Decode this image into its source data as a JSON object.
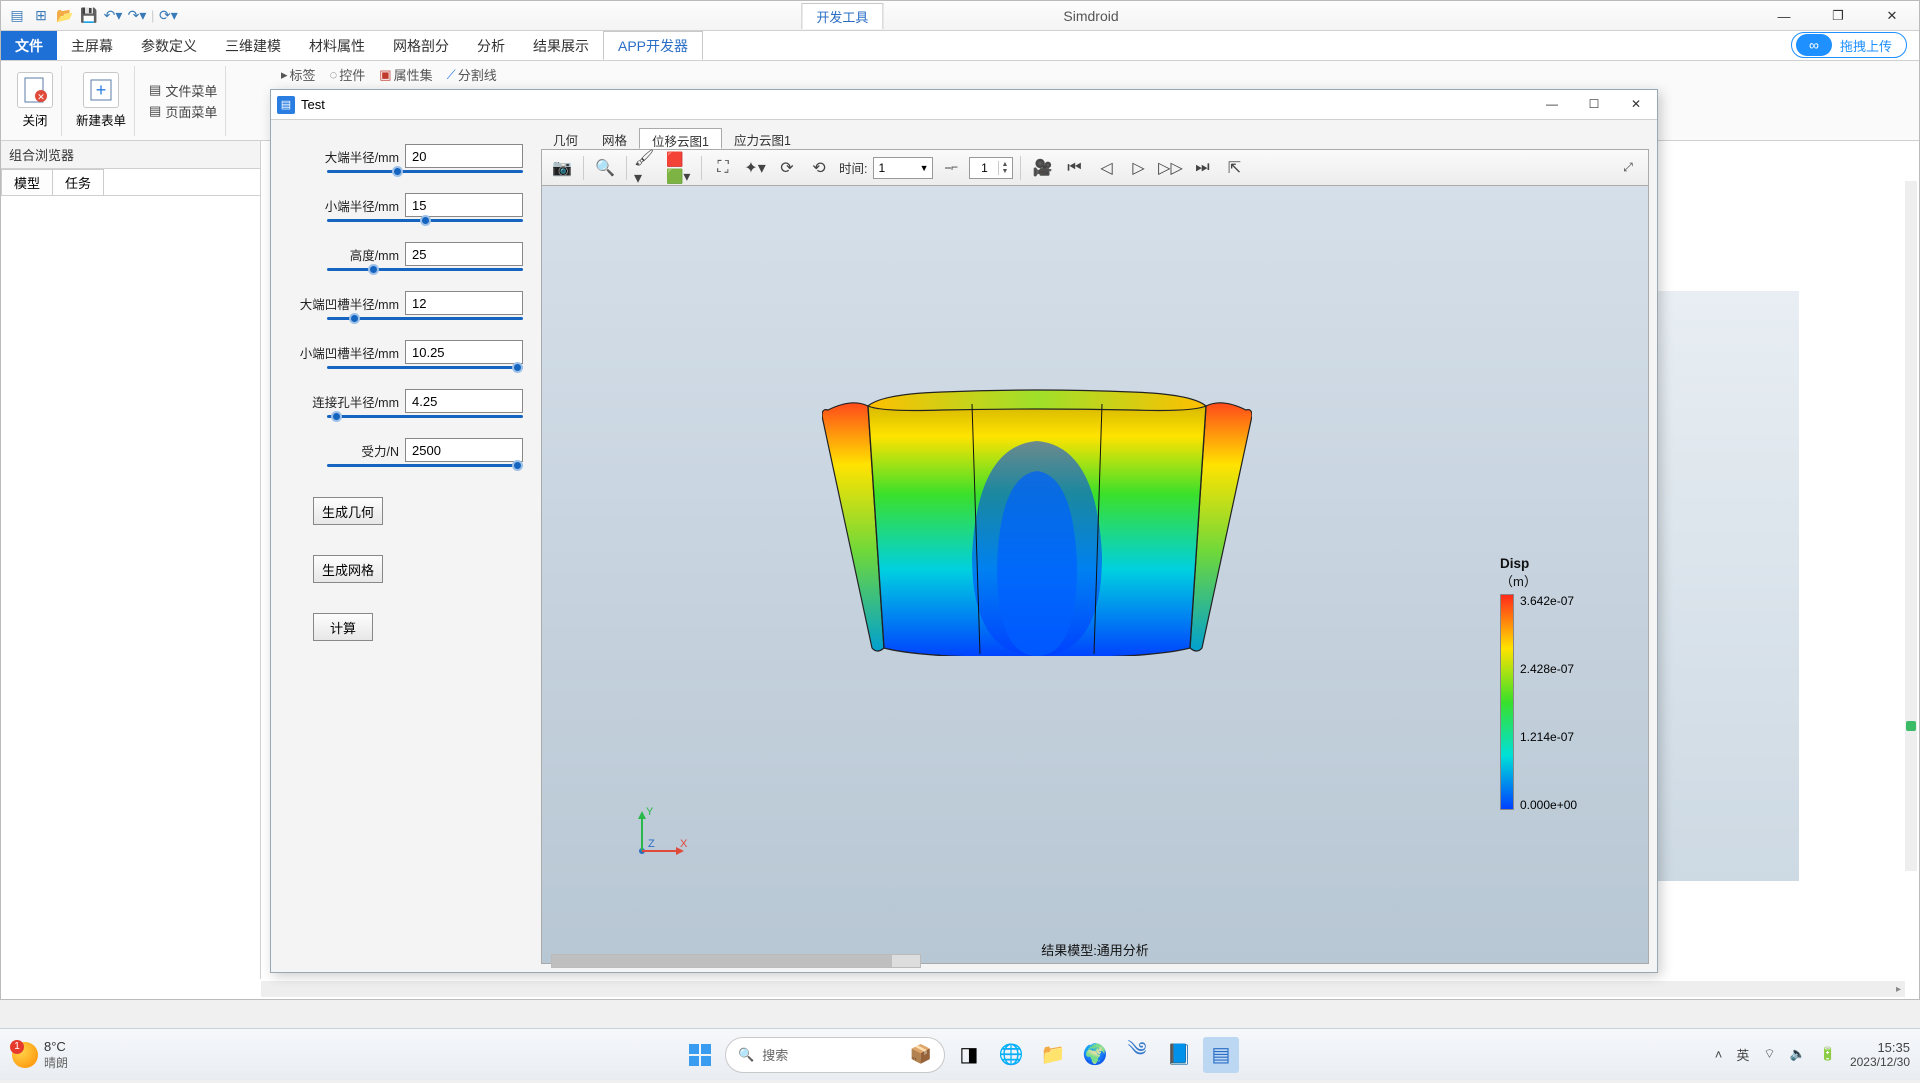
{
  "app": {
    "name": "Simdroid",
    "dev_tools_tab": "开发工具"
  },
  "qat_icons": [
    "app",
    "new",
    "open",
    "save",
    "undo",
    "redo",
    "refresh"
  ],
  "menu": {
    "file": "文件",
    "tabs": [
      "主屏幕",
      "参数定义",
      "三维建模",
      "材料属性",
      "网格剖分",
      "分析",
      "结果展示",
      "APP开发器"
    ],
    "active": "APP开发器",
    "upload": "拖拽上传"
  },
  "ribbon": {
    "close": "关闭",
    "new_form": "新建表单",
    "file_menu": "文件菜单",
    "page_menu": "页面菜单",
    "partial": [
      "标签",
      "控件",
      "属性集",
      "分割线"
    ]
  },
  "left_panel": {
    "title": "组合浏览器",
    "tabs": [
      "模型",
      "任务"
    ],
    "active": "任务"
  },
  "child": {
    "title": "Test",
    "params": [
      {
        "label": "大端半径/mm",
        "value": "20",
        "pos": 35
      },
      {
        "label": "小端半径/mm",
        "value": "15",
        "pos": 50
      },
      {
        "label": "高度/mm",
        "value": "25",
        "pos": 22
      },
      {
        "label": "大端凹槽半径/mm",
        "value": "12",
        "pos": 12
      },
      {
        "label": "小端凹槽半径/mm",
        "value": "10.25",
        "pos": 100
      },
      {
        "label": "连接孔半径/mm",
        "value": "4.25",
        "pos": 2
      },
      {
        "label": "受力/N",
        "value": "2500",
        "pos": 100
      }
    ],
    "buttons": [
      "生成几何",
      "生成网格",
      "计算"
    ],
    "viewer_tabs": [
      "几何",
      "网格",
      "位移云图1",
      "应力云图1"
    ],
    "viewer_active": "位移云图1",
    "toolbar": {
      "time_label": "时间:",
      "time_value": "1",
      "spin_value": "1"
    },
    "result_caption": "结果模型:通用分析",
    "colorbar": {
      "title": "Disp",
      "unit": "（m）",
      "labels": [
        "3.642e-07",
        "2.428e-07",
        "1.214e-07",
        "0.000e+00"
      ]
    }
  },
  "taskbar": {
    "temp": "8°C",
    "cond": "晴朗",
    "search": "搜索",
    "lang": "英",
    "time": "15:35",
    "date": "2023/12/30"
  }
}
